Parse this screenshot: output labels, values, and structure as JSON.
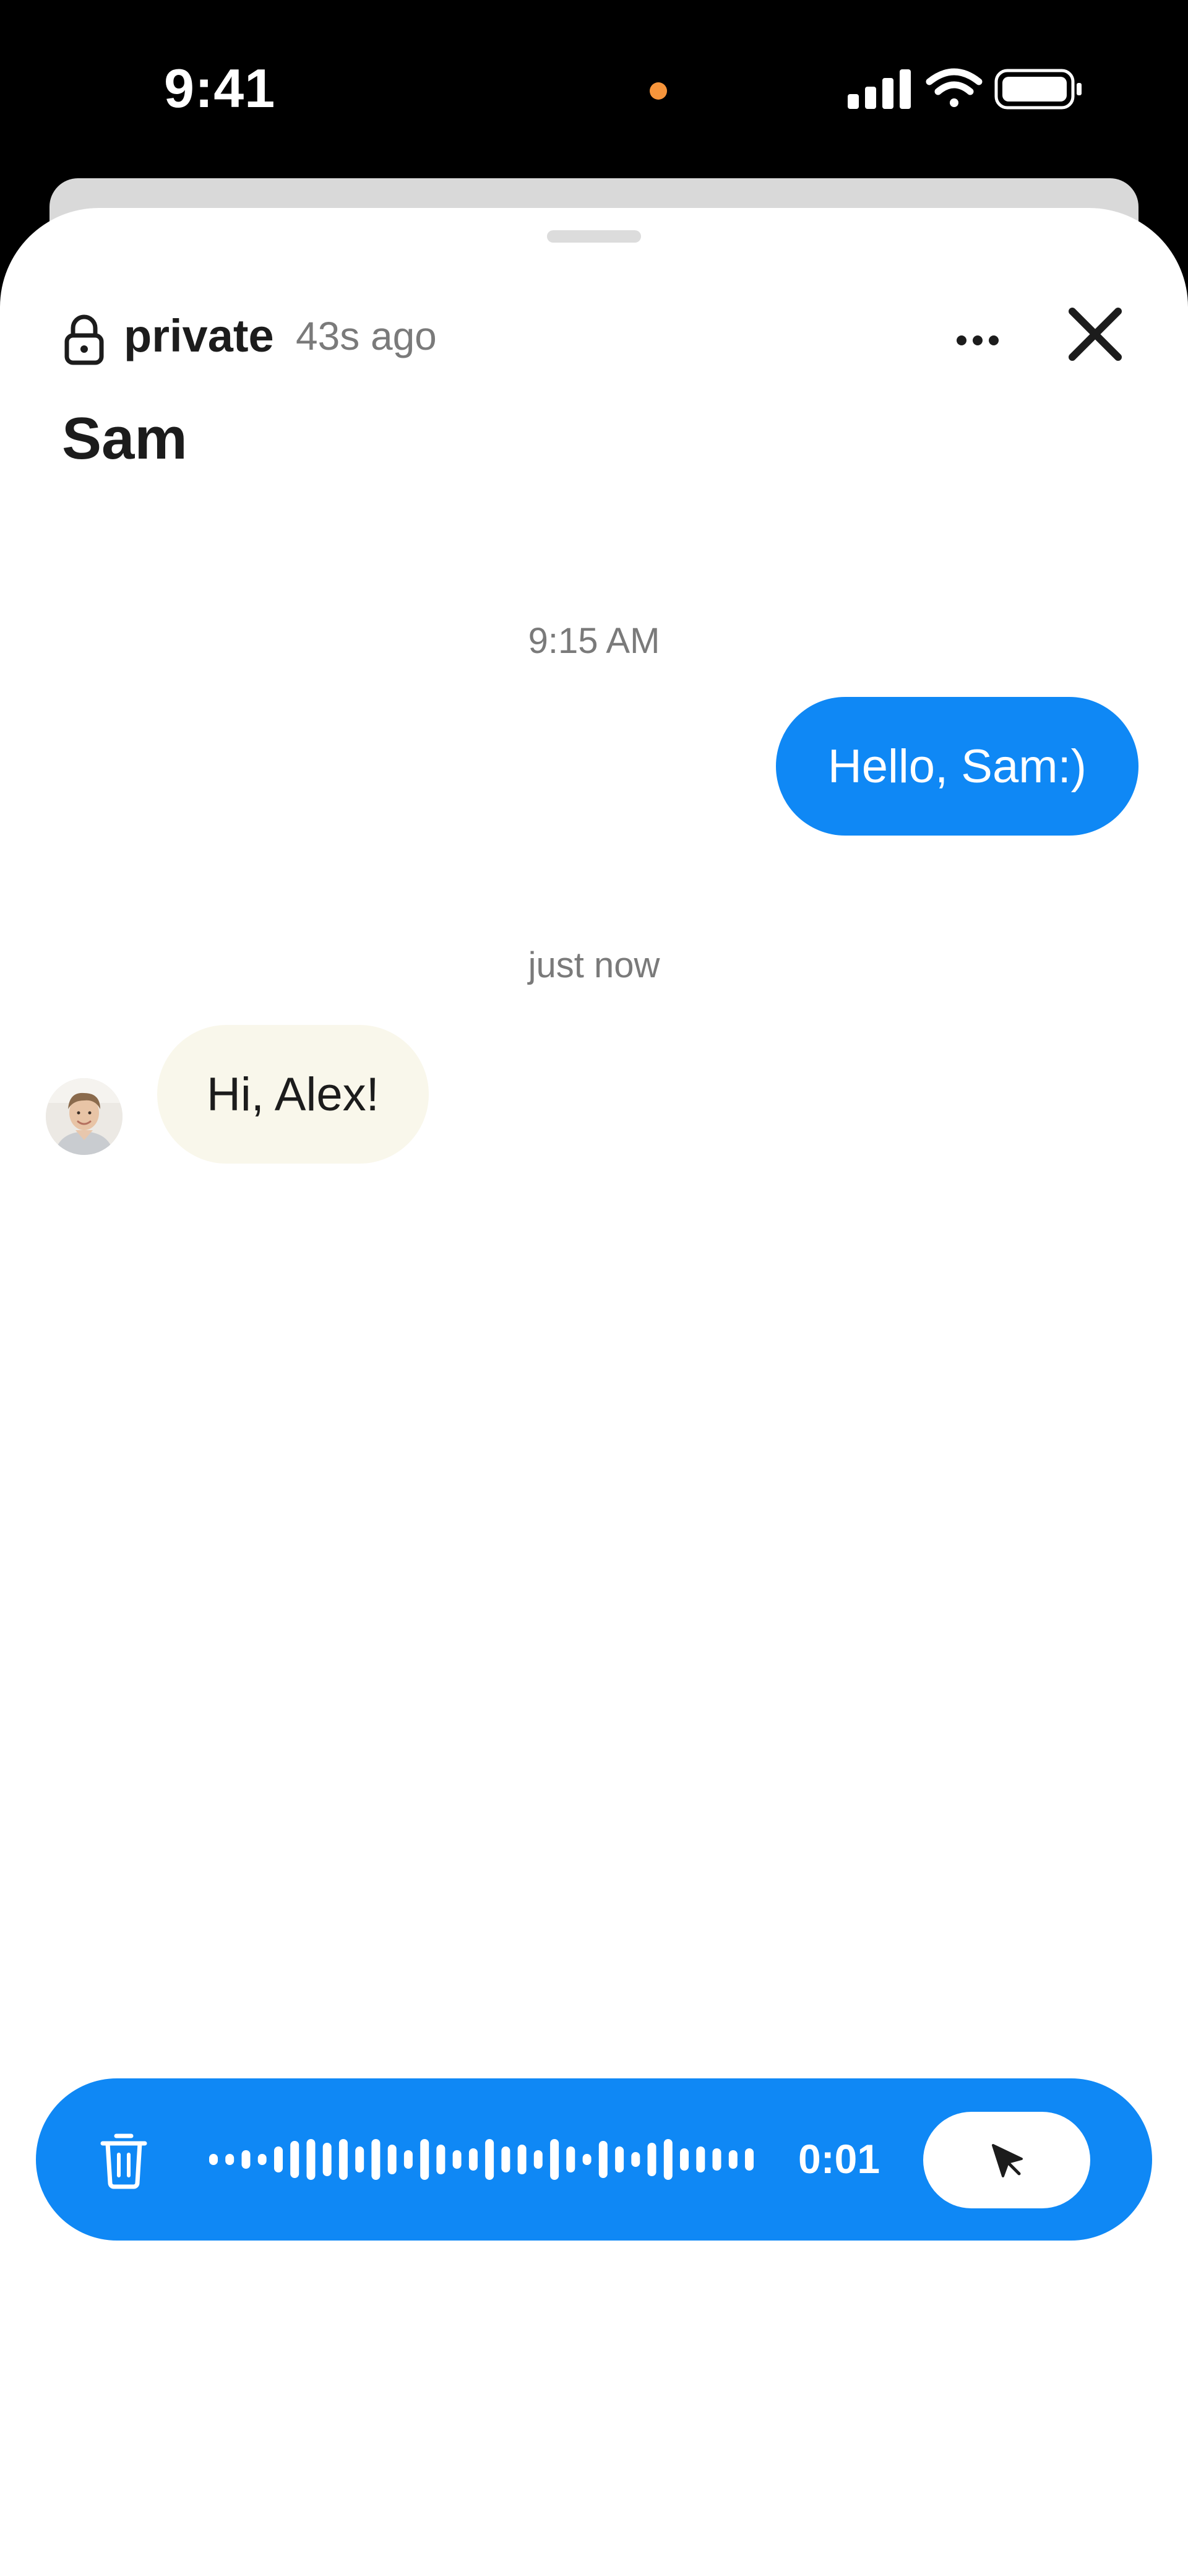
{
  "status_bar": {
    "time": "9:41",
    "indicator_color": "#f7953b"
  },
  "header": {
    "privacy_label": "private",
    "last_seen": "43s ago",
    "more_icon": "ellipsis-icon",
    "close_icon": "close-icon",
    "lock_icon": "lock-icon"
  },
  "chat": {
    "title": "Sam"
  },
  "messages": [
    {
      "timestamp": "9:15 AM",
      "direction": "outgoing",
      "text": "Hello, Sam:)"
    },
    {
      "timestamp": "just now",
      "direction": "incoming",
      "text": "Hi, Alex!",
      "sender_avatar": "avatar"
    }
  ],
  "recorder": {
    "duration": "0:01",
    "trash_icon": "trash-icon",
    "send_icon": "send-icon",
    "waveform": [
      0.15,
      0.15,
      0.25,
      0.15,
      0.35,
      0.5,
      0.55,
      0.45,
      0.55,
      0.35,
      0.55,
      0.4,
      0.25,
      0.55,
      0.4,
      0.25,
      0.3,
      0.55,
      0.35,
      0.4,
      0.25,
      0.55,
      0.35,
      0.15,
      0.5,
      0.35,
      0.2,
      0.45,
      0.55,
      0.3,
      0.35,
      0.3,
      0.25,
      0.3
    ],
    "accent_color": "#0f88f5"
  },
  "colors": {
    "outgoing_bubble": "#0f88f5",
    "incoming_bubble": "#f9f7eb",
    "muted_text": "#7a7a7a"
  }
}
